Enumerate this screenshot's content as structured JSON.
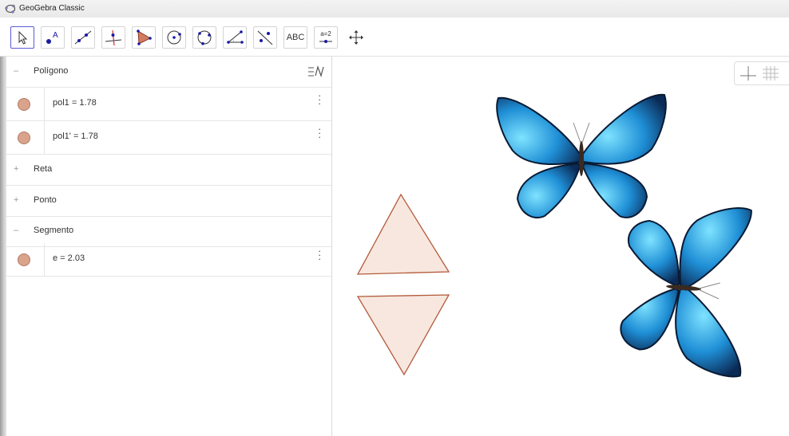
{
  "window": {
    "title": "GeoGebra Classic"
  },
  "toolbar": {
    "tools": [
      {
        "name": "move-tool"
      },
      {
        "name": "point-tool"
      },
      {
        "name": "line-tool"
      },
      {
        "name": "perpendicular-line-tool"
      },
      {
        "name": "polygon-tool"
      },
      {
        "name": "circle-center-point-tool"
      },
      {
        "name": "circle-three-points-tool"
      },
      {
        "name": "angle-tool"
      },
      {
        "name": "reflect-about-line-tool"
      },
      {
        "name": "text-tool",
        "label": "ABC"
      },
      {
        "name": "slider-tool",
        "label": "a=2"
      },
      {
        "name": "move-graphics-view-tool"
      }
    ]
  },
  "algebra": {
    "groups": [
      {
        "sign": "–",
        "name": "Polígono"
      },
      {
        "sign": "+",
        "name": "Reta"
      },
      {
        "sign": "+",
        "name": "Ponto"
      },
      {
        "sign": "–",
        "name": "Segmento"
      }
    ],
    "items": [
      {
        "expr": "pol1 = 1.78",
        "color": "#d9a48b"
      },
      {
        "expr": "pol1' = 1.78",
        "color": "#d9a48b"
      },
      {
        "expr": "e = 2.03",
        "color": "#d9a48b"
      }
    ]
  },
  "graphics": {
    "polygon_fill": "#f7e7df",
    "polygon_stroke": "#b35a3a",
    "butterfly_blue": "#1f8fd6"
  }
}
